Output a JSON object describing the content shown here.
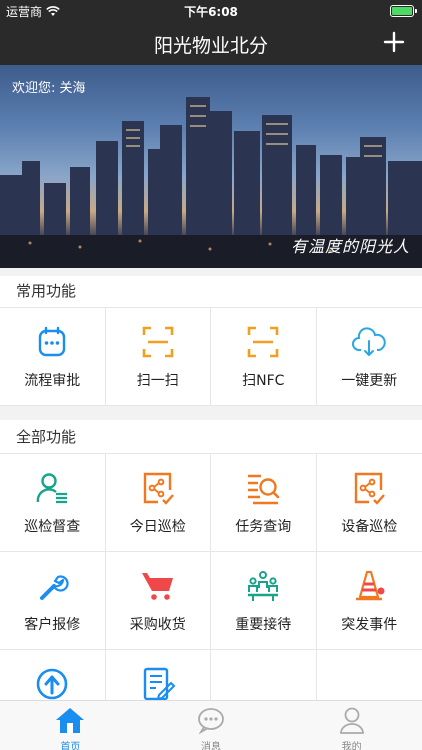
{
  "status": {
    "carrier": "运营商",
    "time": "下午6:08"
  },
  "header": {
    "title": "阳光物业北分"
  },
  "banner": {
    "welcome": "欢迎您: 关海",
    "slogan": "有温度的阳光人"
  },
  "common": {
    "title": "常用功能",
    "items": [
      {
        "label": "流程审批",
        "icon": "approval-icon"
      },
      {
        "label": "扫一扫",
        "icon": "scan-icon"
      },
      {
        "label": "扫NFC",
        "icon": "nfc-scan-icon"
      },
      {
        "label": "一键更新",
        "icon": "cloud-download-icon"
      }
    ]
  },
  "all": {
    "title": "全部功能",
    "items": [
      {
        "label": "巡检督查",
        "icon": "inspector-icon"
      },
      {
        "label": "今日巡检",
        "icon": "share-check-icon"
      },
      {
        "label": "任务查询",
        "icon": "search-list-icon"
      },
      {
        "label": "设备巡检",
        "icon": "device-check-icon"
      },
      {
        "label": "客户报修",
        "icon": "wrench-icon"
      },
      {
        "label": "采购收货",
        "icon": "cart-icon"
      },
      {
        "label": "重要接待",
        "icon": "meeting-icon"
      },
      {
        "label": "突发事件",
        "icon": "traffic-cone-icon"
      },
      {
        "label": "",
        "icon": "upload-circle-icon"
      },
      {
        "label": "",
        "icon": "edit-form-icon"
      }
    ]
  },
  "tabs": [
    {
      "label": "首页",
      "icon": "home-icon"
    },
    {
      "label": "消息",
      "icon": "message-icon"
    },
    {
      "label": "我的",
      "icon": "profile-icon"
    }
  ],
  "colors": {
    "bar": "#2a2a2a",
    "accent": "#1a8ef0",
    "orange": "#f0a020",
    "green": "#1aa38a",
    "red": "#f04848"
  }
}
